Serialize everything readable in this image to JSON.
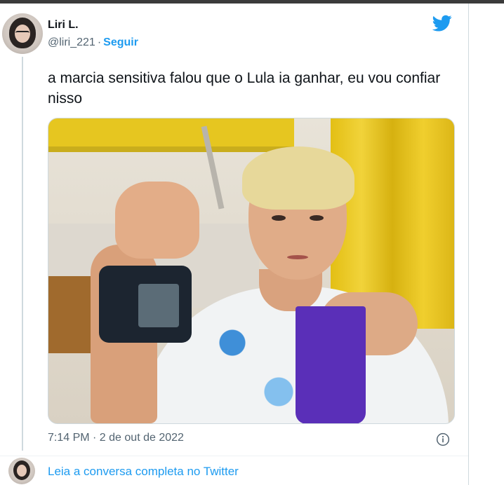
{
  "tweet": {
    "author_name": "Liri L.",
    "handle": "@liri_221",
    "separator": "·",
    "follow_label": "Seguir",
    "text": "a marcia sensitiva falou que o Lula ia ganhar, eu vou confiar nisso",
    "timestamp": "7:14 PM · 2 de out de 2022",
    "read_conversation": "Leia a conversa completa no Twitter"
  },
  "colors": {
    "accent": "#1d9bf0",
    "text": "#0f1419",
    "muted": "#536471",
    "border": "#cfd9de"
  },
  "icons": {
    "brand": "twitter-bird-icon",
    "info": "info-icon"
  }
}
